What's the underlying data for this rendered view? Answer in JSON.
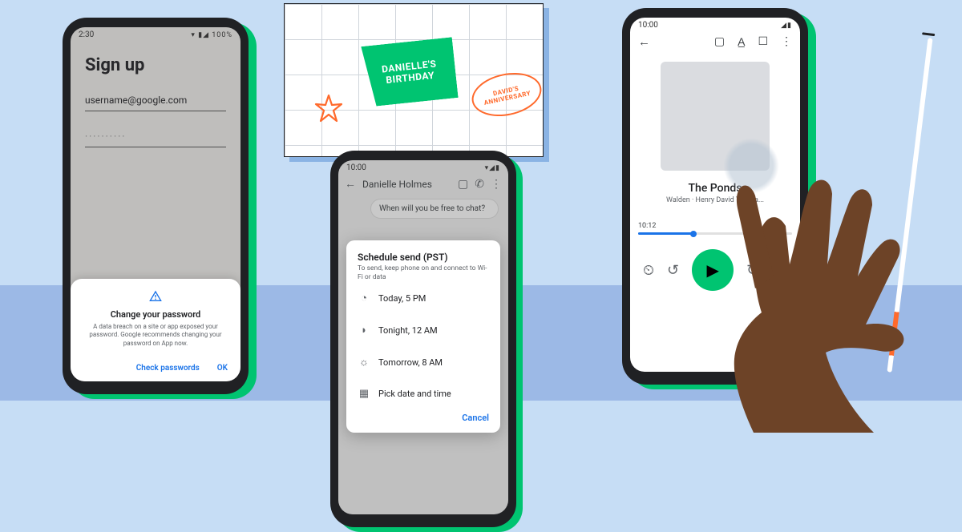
{
  "phone1": {
    "status_time": "2:30",
    "status_icons": "▾ ▮◢ 100%",
    "title": "Sign up",
    "username": "username@google.com",
    "password_mask": "··········",
    "sheet": {
      "title": "Change your password",
      "body": "A data breach on a site or app exposed your password. Google recommends changing your password on App now.",
      "check": "Check passwords",
      "ok": "OK"
    }
  },
  "phone2": {
    "status_time": "10:00",
    "contact": "Danielle Holmes",
    "msg": "When will you be free to chat?",
    "dialog": {
      "title": "Schedule send (PST)",
      "sub": "To send, keep phone on and connect to Wi-Fi or data",
      "opt1": "Today, 5 PM",
      "opt2": "Tonight, 12 AM",
      "opt3": "Tomorrow, 8 AM",
      "opt4": "Pick date and time",
      "cancel": "Cancel"
    }
  },
  "phone3": {
    "status_time": "10:00",
    "title": "The Ponds",
    "sub": "Walden · Henry David Thorea...",
    "time": "10:12"
  },
  "calendar": {
    "sticky": "DANIELLE'S BIRTHDAY",
    "ring": "DAVID'S ANNIVERSARY"
  }
}
